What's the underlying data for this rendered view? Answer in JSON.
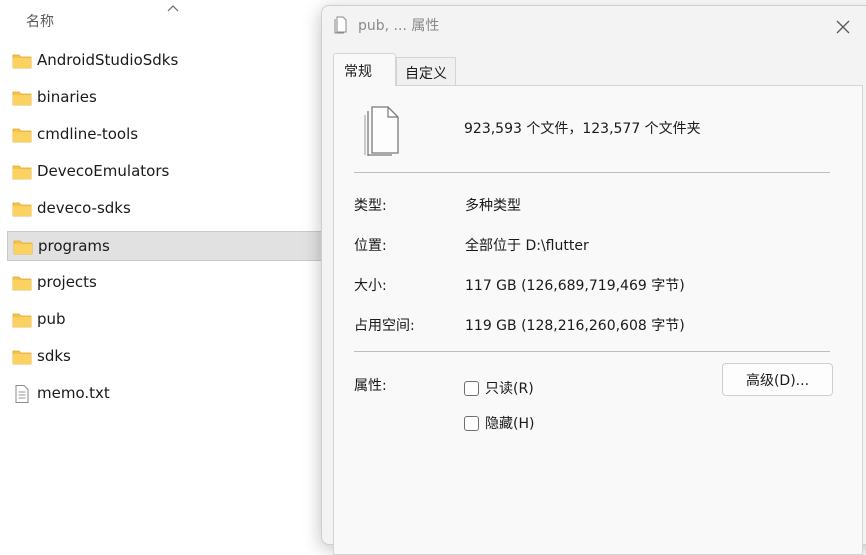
{
  "explorer": {
    "column_header": "名称",
    "items": [
      {
        "name": "AndroidStudioSdks",
        "type": "folder"
      },
      {
        "name": "binaries",
        "type": "folder"
      },
      {
        "name": "cmdline-tools",
        "type": "folder"
      },
      {
        "name": "DevecoEmulators",
        "type": "folder"
      },
      {
        "name": "deveco-sdks",
        "type": "folder"
      },
      {
        "name": "programs",
        "type": "folder",
        "selected": true
      },
      {
        "name": "projects",
        "type": "folder"
      },
      {
        "name": "pub",
        "type": "folder"
      },
      {
        "name": "sdks",
        "type": "folder"
      },
      {
        "name": "memo.txt",
        "type": "file"
      }
    ]
  },
  "dialog": {
    "title": "pub, ... 属性",
    "tabs": [
      {
        "label": "常规",
        "active": true
      },
      {
        "label": "自定义",
        "active": false
      }
    ],
    "summary": "923,593 个文件，123,577 个文件夹",
    "properties": [
      {
        "label": "类型:",
        "value": "多种类型"
      },
      {
        "label": "位置:",
        "value": "全部位于 D:\\flutter"
      },
      {
        "label": "大小:",
        "value": "117 GB (126,689,719,469 字节)"
      },
      {
        "label": "占用空间:",
        "value": "119 GB (128,216,260,608 字节)"
      }
    ],
    "attributes_label": "属性:",
    "readonly_label": "只读(R)",
    "hidden_label": "隐藏(H)",
    "advanced_button": "高级(D)..."
  },
  "colors": {
    "folder": "#f8c34b",
    "folder_dark": "#e6a817",
    "selection": "#e1e1e1"
  }
}
